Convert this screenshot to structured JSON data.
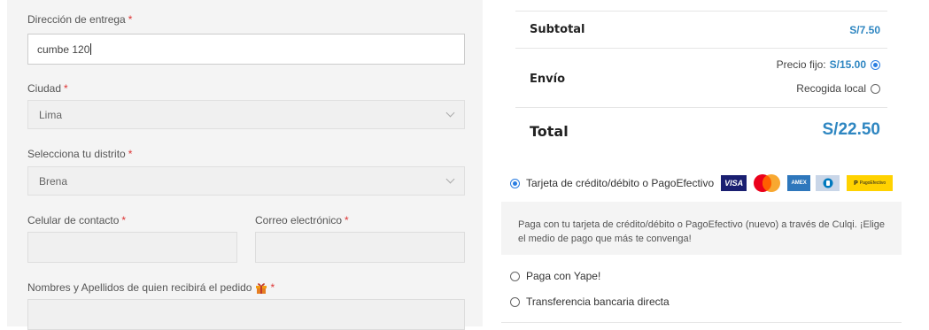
{
  "form": {
    "address": {
      "label": "Dirección de entrega",
      "required": "*",
      "value": "cumbe 120"
    },
    "city": {
      "label": "Ciudad",
      "required": "*",
      "value": "Lima"
    },
    "district": {
      "label": "Selecciona tu distrito",
      "required": "*",
      "value": "Brena"
    },
    "phone": {
      "label": "Celular de contacto",
      "required": "*",
      "value": ""
    },
    "email": {
      "label": "Correo electrónico",
      "required": "*",
      "value": ""
    },
    "recipient": {
      "label": "Nombres y Apellidos de quien recibirá el pedido",
      "required": "*",
      "value": ""
    }
  },
  "summary": {
    "subtotal_label": "Subtotal",
    "subtotal_value": "S/7.50",
    "shipping_label": "Envío",
    "shipping_options": [
      {
        "label": "Precio fijo:",
        "price": "S/15.00",
        "selected": true
      },
      {
        "label": "Recogida local",
        "price": "",
        "selected": false
      }
    ],
    "total_label": "Total",
    "total_value": "S/22.50"
  },
  "payment": {
    "methods": [
      {
        "label": "Tarjeta de crédito/débito o PagoEfectivo",
        "selected": true
      },
      {
        "label": "Paga con Yape!",
        "selected": false
      },
      {
        "label": "Transferencia bancaria directa",
        "selected": false
      }
    ],
    "description": "Paga con tu tarjeta de crédito/débito o PagoEfectivo (nuevo) a través de Culqi. ¡Elige el medio de pago que más te convenga!",
    "cards": {
      "visa": "VISA",
      "amex": "AMEX",
      "pagoefectivo": "PagoEfectivo"
    }
  },
  "colors": {
    "accent": "#2e86c1",
    "required": "#dd3333",
    "visa": "#1a1f71",
    "pagoefectivo": "#ffd200"
  }
}
